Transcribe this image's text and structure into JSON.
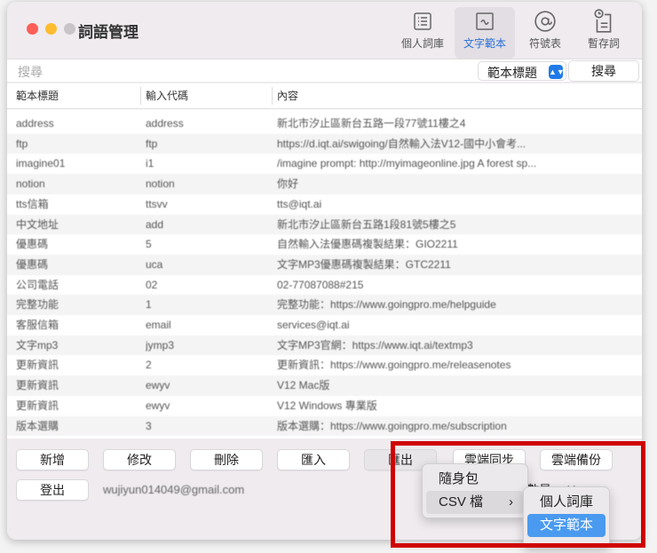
{
  "window": {
    "title": "詞語管理"
  },
  "toolbar": [
    {
      "label": "個人詞庫",
      "icon": "list-icon"
    },
    {
      "label": "文字範本",
      "icon": "waveform-icon",
      "active": true
    },
    {
      "label": "符號表",
      "icon": "at-icon"
    },
    {
      "label": "暫存詞",
      "icon": "clipboard-clock-icon"
    }
  ],
  "search": {
    "placeholder": "搜尋",
    "field": "範本標題",
    "button": "搜尋"
  },
  "table": {
    "headers": [
      "範本標題",
      "輸入代碼",
      "內容"
    ],
    "rows": [
      [
        "address",
        "address",
        "新北市汐止區新台五路一段77號11樓之4"
      ],
      [
        "ftp",
        "ftp",
        "https://d.iqt.ai/swigoing/自然輸入法V12-國中小會考..."
      ],
      [
        "imagine01",
        "i1",
        "/imagine prompt: http://myimageonline.jpg A forest sp..."
      ],
      [
        "notion",
        "notion",
        "你好"
      ],
      [
        "tts信箱",
        "ttsvv",
        "tts@iqt.ai"
      ],
      [
        "中文地址",
        "add",
        "新北市汐止區新台五路1段81號5樓之5"
      ],
      [
        "優惠碼",
        "5",
        "自然輸入法優惠碼複製結果：GIO2211"
      ],
      [
        "優惠碼",
        "uca",
        "文字MP3優惠碼複製結果：GTC2211"
      ],
      [
        "公司電話",
        "02",
        "02-77087088#215"
      ],
      [
        "完整功能",
        "1",
        "完整功能：https://www.goingpro.me/helpguide"
      ],
      [
        "客服信箱",
        "email",
        "services@iqt.ai"
      ],
      [
        "文字mp3",
        "jymp3",
        "文字MP3官網：https://www.iqt.ai/textmp3"
      ],
      [
        "更新資訊",
        "2",
        "更新資訊：https://www.goingpro.me/releasenotes"
      ],
      [
        "更新資訊",
        "ewyv",
        "V12 Mac版"
      ],
      [
        "更新資訊",
        "ewyv",
        "V12 Windows 專業版"
      ],
      [
        "版本選購",
        "3",
        "版本選購：https://www.goingpro.me/subscription"
      ]
    ]
  },
  "buttons": {
    "add": "新增",
    "edit": "修改",
    "delete": "刪除",
    "import": "匯入",
    "export": "匯出",
    "cloud_sync": "雲端同步",
    "cloud_backup": "雲端備份",
    "logout": "登出"
  },
  "account": {
    "email": "wujiyun014049@gmail.com"
  },
  "count": "數量：41",
  "export_menu": {
    "items": [
      "隨身包",
      "CSV 檔"
    ],
    "submenu": [
      "個人詞庫",
      "文字範本"
    ]
  }
}
